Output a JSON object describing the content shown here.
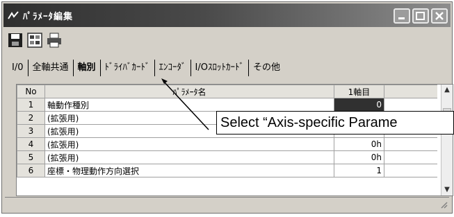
{
  "window": {
    "title": "ﾊﾟﾗﾒｰﾀ編集",
    "controls": [
      "minimize-button",
      "maximize-button",
      "close-button"
    ]
  },
  "toolbar": {
    "tools": [
      "save-icon",
      "settings-icon",
      "print-icon"
    ]
  },
  "tabs": [
    {
      "label": "I/0",
      "active": false
    },
    {
      "label": "全軸共通",
      "active": false
    },
    {
      "label": "軸別",
      "active": true
    },
    {
      "label": "ﾄﾞﾗｲﾊﾞｶｰﾄﾞ",
      "active": false
    },
    {
      "label": "ｴﾝｺｰﾀﾞ",
      "active": false
    },
    {
      "label": "I/Oｽﾛｯﾄｶｰﾄﾞ",
      "active": false
    },
    {
      "label": "その他",
      "active": false
    }
  ],
  "grid": {
    "headers": {
      "no": "No",
      "name": "ﾊﾟﾗﾒｰﾀ名",
      "value": "1軸目"
    },
    "rows": [
      {
        "no": "1",
        "name": "軸動作種別",
        "value": "0"
      },
      {
        "no": "2",
        "name": "(拡張用)",
        "value": ""
      },
      {
        "no": "3",
        "name": "(拡張用)",
        "value": ""
      },
      {
        "no": "4",
        "name": "(拡張用)",
        "value": "0h"
      },
      {
        "no": "5",
        "name": "(拡張用)",
        "value": "0h"
      },
      {
        "no": "6",
        "name": "座標・物理動作方向選択",
        "value": "1"
      }
    ]
  },
  "annotation": {
    "text": "Select “Axis-specific Parame"
  }
}
